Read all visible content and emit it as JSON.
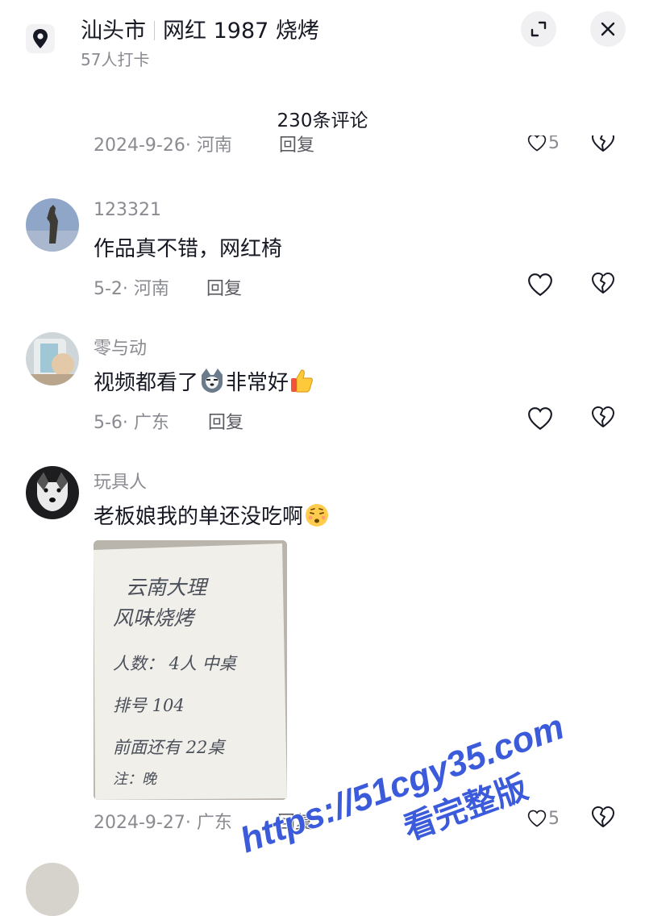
{
  "header": {
    "city": "汕头市",
    "shop_name": "网红 1987 烧烤",
    "checkin": "57人打卡",
    "location_icon": "location-pin-icon",
    "expand_icon": "expand-icon",
    "close_icon": "close-icon"
  },
  "comments_count": "230条评论",
  "partial_comment": {
    "meta": "2024-9-26· 河南",
    "reply": "回复",
    "likes": "5"
  },
  "comments": [
    {
      "username": "123321",
      "text": "作品真不错，网红椅",
      "meta": "5-2· 河南",
      "reply": "回复",
      "likes": ""
    },
    {
      "username": "零与动",
      "text_before": "视频都看了",
      "text_after": "非常好",
      "meta": "5-6· 广东",
      "reply": "回复",
      "likes": ""
    },
    {
      "username": "玩具人",
      "text": "老板娘我的单还没吃啊",
      "meta": "2024-9-27· 广东",
      "reply": "回复",
      "likes": "5",
      "image_text": [
        "云南大理",
        "风味烧烤",
        "人数： 4人 中桌",
        "排号 104",
        "前面还有 22桌",
        "注：晚"
      ]
    }
  ],
  "watermark": {
    "url": "https://51cgy35.com",
    "text": "看完整版",
    "color": "#3b5bdb"
  },
  "colors": {
    "text": "#161823",
    "secondary": "#8a8b91",
    "background": "#ffffff"
  }
}
